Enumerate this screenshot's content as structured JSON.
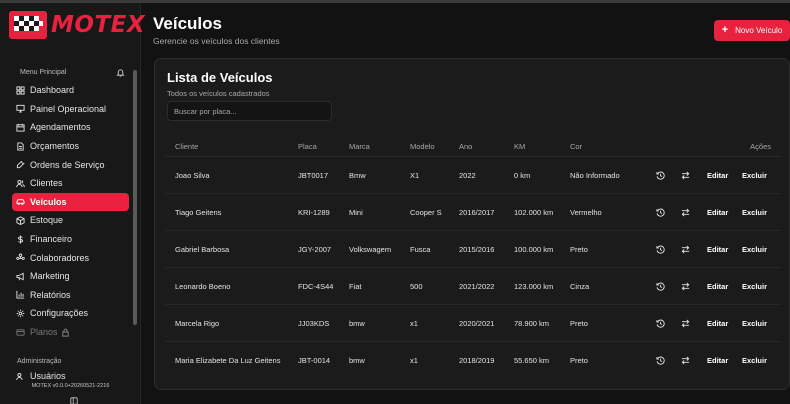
{
  "app": {
    "logo_text": "MOTEX",
    "version": "MOTEX v0.0.0+20260521-2216"
  },
  "sidebar": {
    "section_main": "Menu Principal",
    "items": [
      {
        "label": "Dashboard",
        "icon": "dashboard-icon"
      },
      {
        "label": "Painel Operacional",
        "icon": "monitor-icon"
      },
      {
        "label": "Agendamentos",
        "icon": "calendar-icon"
      },
      {
        "label": "Orçamentos",
        "icon": "document-icon"
      },
      {
        "label": "Ordens de Serviço",
        "icon": "wrench-icon"
      },
      {
        "label": "Clientes",
        "icon": "users-icon"
      },
      {
        "label": "Veículos",
        "icon": "car-icon",
        "active": true
      },
      {
        "label": "Estoque",
        "icon": "box-icon"
      },
      {
        "label": "Financeiro",
        "icon": "dollar-icon"
      },
      {
        "label": "Colaboradores",
        "icon": "team-icon"
      },
      {
        "label": "Marketing",
        "icon": "megaphone-icon"
      },
      {
        "label": "Relatórios",
        "icon": "chart-icon"
      },
      {
        "label": "Configurações",
        "icon": "gear-icon"
      },
      {
        "label": "Planos",
        "icon": "card-icon",
        "disabled": true
      }
    ],
    "section_admin": "Administração",
    "admin_items": [
      {
        "label": "Usuários",
        "icon": "users-icon"
      }
    ]
  },
  "header": {
    "title": "Veículos",
    "subtitle": "Gerencie os veículos dos clientes",
    "new_button": "Novo Veículo"
  },
  "list": {
    "title": "Lista de Veículos",
    "subtitle": "Todos os veículos cadastrados",
    "search_placeholder": "Buscar por placa...",
    "columns": {
      "cliente": "Cliente",
      "placa": "Placa",
      "marca": "Marca",
      "modelo": "Modelo",
      "ano": "Ano",
      "km": "KM",
      "cor": "Cor",
      "acoes": "Ações"
    },
    "edit_label": "Editar",
    "delete_label": "Excluir",
    "rows": [
      {
        "cliente": "Joao Silva",
        "placa": "JBT0017",
        "marca": "Bmw",
        "modelo": "X1",
        "ano": "2022",
        "km": "0 km",
        "cor": "Não Informado"
      },
      {
        "cliente": "Tiago Geitens",
        "placa": "KRI-1289",
        "marca": "Mini",
        "modelo": "Cooper S",
        "ano": "2016/2017",
        "km": "102.000 km",
        "cor": "Vermelho"
      },
      {
        "cliente": "Gabriel Barbosa",
        "placa": "JGY-2007",
        "marca": "Volkswagem",
        "modelo": "Fusca",
        "ano": "2015/2016",
        "km": "100.000 km",
        "cor": "Preto"
      },
      {
        "cliente": "Leonardo Boeno",
        "placa": "FDC-4S44",
        "marca": "Fiat",
        "modelo": "500",
        "ano": "2021/2022",
        "km": "123.000 km",
        "cor": "Cinza"
      },
      {
        "cliente": "Marcela Rigo",
        "placa": "JJ03KDS",
        "marca": "bmw",
        "modelo": "x1",
        "ano": "2020/2021",
        "km": "78.900 km",
        "cor": "Preto"
      },
      {
        "cliente": "Maria Elizabete Da Luz Geitens",
        "placa": "JBT-0014",
        "marca": "bmw",
        "modelo": "x1",
        "ano": "2018/2019",
        "km": "55.650 km",
        "cor": "Preto"
      }
    ]
  },
  "colors": {
    "accent": "#e8223e",
    "background": "#121212",
    "card": "#1b1b1b",
    "sidebar": "#181818"
  }
}
